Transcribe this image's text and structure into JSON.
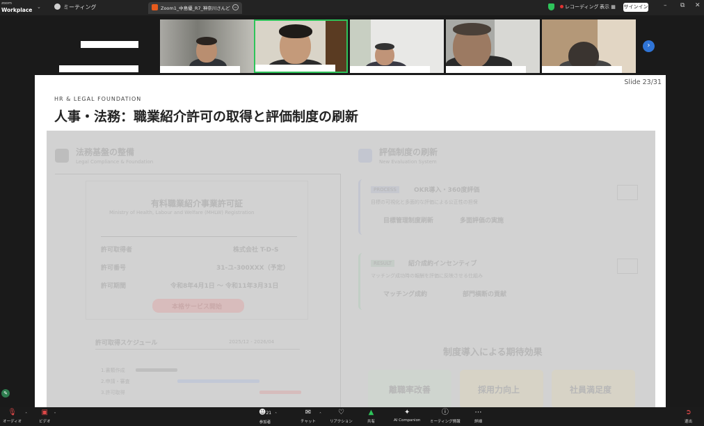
{
  "app": {
    "brand_line1": "zoom",
    "brand_line2": "Workplace",
    "meeting_tab": "ミーティング",
    "doc_tab_title": "Zoom1_中島優_R7_神奈川さんど",
    "recording": "レコーディング",
    "view": "表示",
    "sign_in": "サインイン"
  },
  "slide": {
    "number": "Slide 23/31",
    "overline": "HR & LEGAL FOUNDATION",
    "title": "人事・法務：職業紹介許可の取得と評価制度の刷新"
  },
  "faded": {
    "left_heading": "法務基盤の整備",
    "left_sub": "Legal Compliance & Foundation",
    "license_title": "有料職業紹介事業許可証",
    "license_sub": "Ministry of Health, Labour and Welfare (MHLW) Registration",
    "row1_label": "許可取得者",
    "row1_value": "株式会社 T-D-S",
    "row2_label": "許可番号",
    "row2_value": "31-ユ-300XXX（予定）",
    "row3_label": "許可期間",
    "row3_value": "令和8年4月1日 ～ 令和11年3月31日",
    "pill": "本格サービス開始",
    "schedule_title": "許可取得スケジュール",
    "schedule_right": "2025/12 - 2026/04",
    "sched_row1": "1.書類作成",
    "sched_row2": "2.申請・審査",
    "sched_row3": "3.許可取得",
    "right_heading": "評価制度の刷新",
    "right_sub": "New Evaluation System",
    "process_badge": "PROCESS",
    "process_title": "OKR導入・360度評価",
    "process_desc": "目標の可視化と多面的な評価による公正性の担保",
    "process_item1": "目標管理制度刷新",
    "process_item2": "多面評価の実施",
    "result_badge": "RESULT",
    "result_title": "紹介成約インセンティブ",
    "result_desc": "マッチング成功時の報酬を評価に反映させる仕組み",
    "result_item1": "マッチング成約",
    "result_item2": "部門横断の貢献",
    "effects_title": "制度導入による期待効果",
    "effect1": "離職率改善",
    "effect2": "採用力向上",
    "effect3": "社員満足度"
  },
  "toolbar": {
    "audio": "オーディオ",
    "video": "ビデオ",
    "participants": "参加者",
    "participants_count": "21",
    "chat": "チャット",
    "reactions": "リアクション",
    "share": "共有",
    "ai_companion": "AI Companion",
    "info": "ミーティング情報",
    "more": "詳細",
    "leave": "退出"
  }
}
